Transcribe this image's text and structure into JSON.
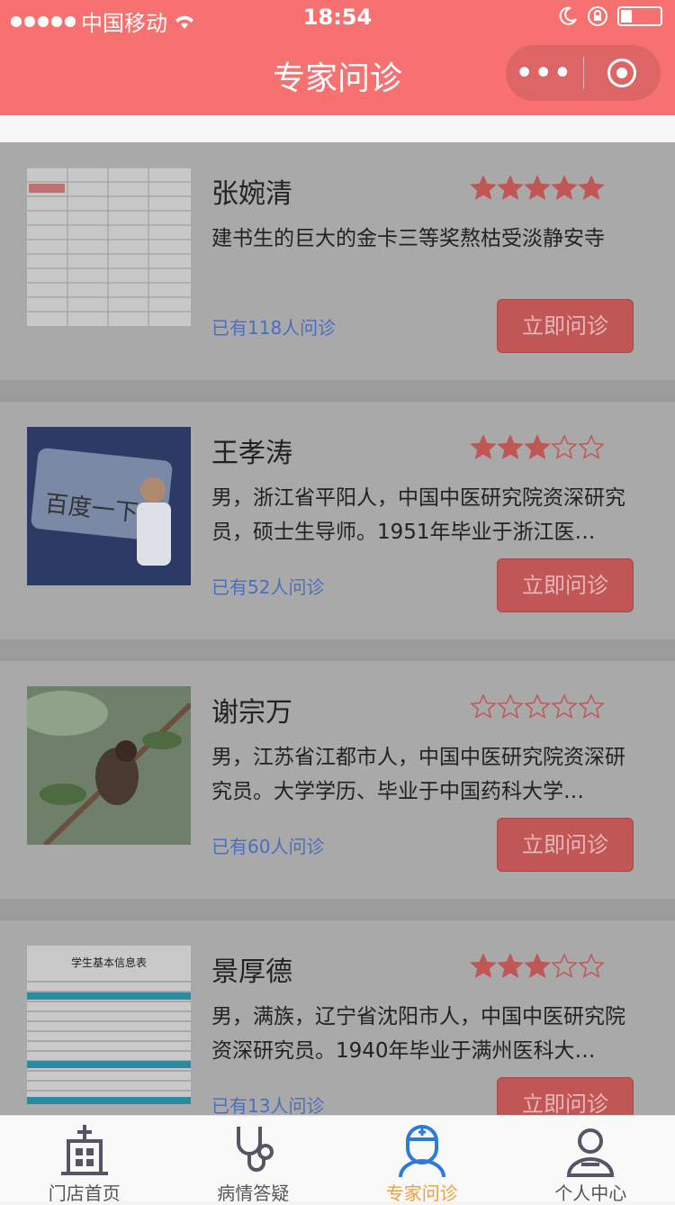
{
  "status_bar": {
    "carrier": "中国移动",
    "time": "18:54"
  },
  "nav": {
    "title": "专家问诊",
    "more": "•••"
  },
  "doctors": [
    {
      "name": "张婉清",
      "rating": 5,
      "description": "建书生的巨大的金卡三等奖熬枯受淡静安寺",
      "consult_count": "已有118人问诊",
      "button_label": "立即问诊",
      "thumb": "table-document-image"
    },
    {
      "name": "王孝涛",
      "rating": 3,
      "description": "男，浙江省平阳人，中国中医研究院资深研究员，硕士生导师。1951年毕业于浙江医…",
      "consult_count": "已有52人问诊",
      "button_label": "立即问诊",
      "thumb": "speaker-photo",
      "thumb_text": "百度一下"
    },
    {
      "name": "谢宗万",
      "rating": 0,
      "description": "男，江苏省江都市人，中国中医研究院资深研究员。大学学历、毕业于中国药科大学…",
      "consult_count": "已有60人问诊",
      "button_label": "立即问诊",
      "thumb": "bird-photo"
    },
    {
      "name": "景厚德",
      "rating": 3,
      "description": "男，满族，辽宁省沈阳市人，中国中医研究院资深研究员。1940年毕业于满州医科大…",
      "consult_count": "已有13人问诊",
      "button_label": "立即问诊",
      "thumb": "student-info-form",
      "thumb_text": "学生基本信息表"
    }
  ],
  "tabs": [
    {
      "label": "门店首页",
      "icon": "store-icon",
      "active": false
    },
    {
      "label": "病情答疑",
      "icon": "stethoscope-icon",
      "active": false
    },
    {
      "label": "专家问诊",
      "icon": "doctor-icon",
      "active": true
    },
    {
      "label": "个人中心",
      "icon": "user-icon",
      "active": false
    }
  ],
  "colors": {
    "brand": "#f87171",
    "button": "#c05656",
    "star": "#c05656",
    "active_tab": "#f0a03c",
    "count_text": "#4a6fbf"
  }
}
